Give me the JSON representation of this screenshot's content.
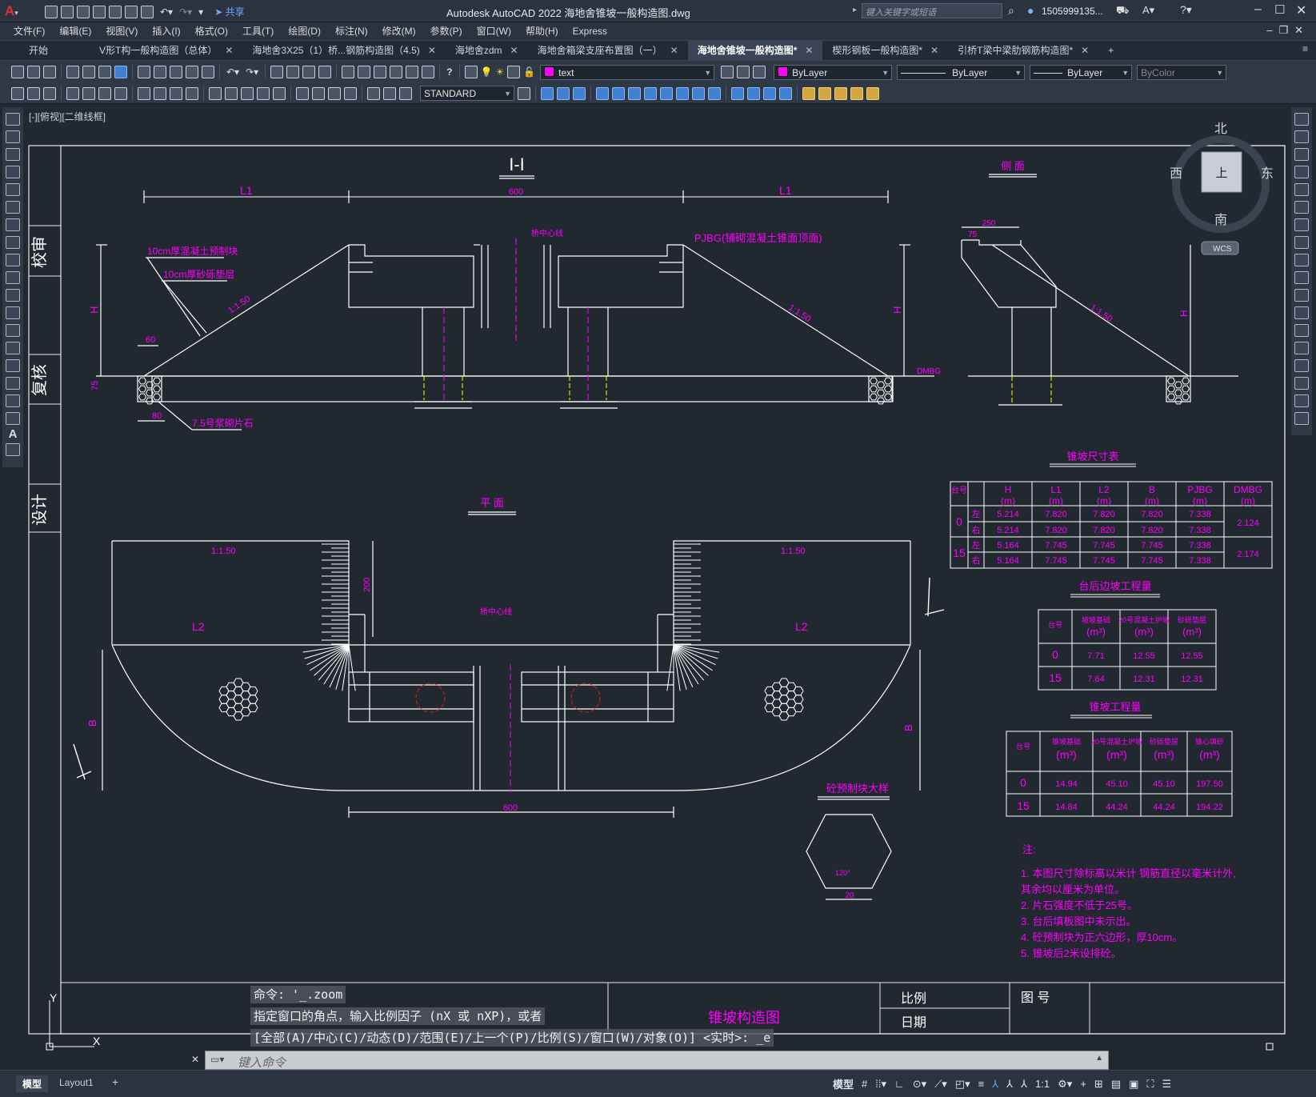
{
  "app": {
    "title": "Autodesk AutoCAD 2022    海地舍锥坡一般构造图.dwg",
    "search_placeholder": "键入关键字或短语",
    "user": "1505999135...",
    "share_label": "共享"
  },
  "menu": [
    "文件(F)",
    "编辑(E)",
    "视图(V)",
    "插入(I)",
    "格式(O)",
    "工具(T)",
    "绘图(D)",
    "标注(N)",
    "修改(M)",
    "参数(P)",
    "窗口(W)",
    "帮助(H)",
    "Express"
  ],
  "tabs": [
    {
      "label": "开始",
      "active": false
    },
    {
      "label": "V形T构一般构造图（总体）",
      "active": false
    },
    {
      "label": "海地舍3X25（1）桥...钢筋构造图（4.5)",
      "active": false
    },
    {
      "label": "海地舍zdm",
      "active": false
    },
    {
      "label": "海地舍箱梁支座布置图（一）",
      "active": false
    },
    {
      "label": "海地舍锥坡一般构造图*",
      "active": true
    },
    {
      "label": "楔形钢板一般构造图*",
      "active": false
    },
    {
      "label": "引桥T梁中梁肋钢筋构造图*",
      "active": false
    }
  ],
  "layer": {
    "name": "text",
    "color": "#ff00ff"
  },
  "properties": {
    "color": "ByLayer",
    "linetype": "ByLayer",
    "lineweight": "ByLayer",
    "plotstyle": "ByColor"
  },
  "textstyle": "STANDARD",
  "viewport_label": "[-][俯视][二维线框]",
  "viewcube": {
    "north": "北",
    "south": "南",
    "east": "东",
    "west": "西",
    "top": "上",
    "wcs": "WCS"
  },
  "drawing": {
    "border_labels": [
      "校审",
      "复核",
      "设计"
    ],
    "section_title": "I-I",
    "side_title": "侧 面",
    "plan_title": "平 面",
    "detail_title": "砼预制块大样",
    "slope_label": "1:1.50",
    "dims": {
      "l1": "L1",
      "l2": "L2",
      "span": "600",
      "h": "H",
      "b": "B",
      "d200": "200",
      "d60": "60",
      "d20": "20",
      "d75": "75",
      "d80": "80",
      "d250": "250",
      "d75b": "75",
      "d20b": "20",
      "angle": "120°"
    },
    "bridge_center": "桥中心线",
    "pjbg_note": "PJBG(铺砌混凝土锥面顶面)",
    "dmbg": "DMBG",
    "layer_note1": "10cm厚混凝土预制块",
    "layer_note2": "10cm厚砂砾垫层",
    "stone_note": "7.5号浆砌片石",
    "notes_header": "注:",
    "notes": [
      "1. 本图尺寸除标高以米计      钢筋直径以毫米计外,",
      "   其余均以厘米为单位。",
      "2. 片石强度不低于25号。",
      "3. 台后填板图中未示出。",
      "4. 砼预制块为正六边形，厚10cm。",
      "5. 锥坡后2米设排砼。"
    ],
    "footer": {
      "scale_label": "比例",
      "date_label": "日期",
      "drawing_no_label": "图 号",
      "title": "锥坡构造图"
    },
    "table1": {
      "title": "锥坡尺寸表",
      "headers": [
        "台号",
        "",
        "H (m)",
        "L1 (m)",
        "L2 (m)",
        "B (m)",
        "PJBG (m)",
        "DMBG (m)"
      ],
      "rows": [
        [
          "0",
          "左",
          "5.214",
          "7.820",
          "7.820",
          "7.820",
          "7.338",
          "2.124"
        ],
        [
          "",
          "右",
          "5.214",
          "7.820",
          "7.820",
          "7.820",
          "7.338",
          ""
        ],
        [
          "15",
          "左",
          "5.164",
          "7.745",
          "7.745",
          "7.745",
          "7.338",
          "2.174"
        ],
        [
          "",
          "右",
          "5.164",
          "7.745",
          "7.745",
          "7.745",
          "7.338",
          ""
        ]
      ]
    },
    "table2": {
      "title": "台后边坡工程量",
      "headers": [
        "台号",
        "坡坡基础 (m³)",
        "20号混凝土护坡 (m³)",
        "砂砾垫层 (m³)"
      ],
      "rows": [
        [
          "0",
          "7.71",
          "12.55",
          "12.55"
        ],
        [
          "15",
          "7.64",
          "12.31",
          "12.31"
        ]
      ]
    },
    "table3": {
      "title": "锥坡工程量",
      "headers": [
        "台号",
        "锥坡基础 (m³)",
        "20号混凝土护坡 (m³)",
        "砂砾垫层 (m³)",
        "锥心填砂 (m³)"
      ],
      "rows": [
        [
          "0",
          "14.94",
          "45.10",
          "45.10",
          "197.50"
        ],
        [
          "15",
          "14.84",
          "44.24",
          "44.24",
          "194.22"
        ]
      ]
    }
  },
  "command": {
    "history": [
      "命令: '_.zoom",
      "指定窗口的角点，输入比例因子 (nX 或 nXP)，或者",
      "[全部(A)/中心(C)/动态(D)/范围(E)/上一个(P)/比例(S)/窗口(W)/对象(O)] <实时>: _e"
    ],
    "placeholder": "键入命令"
  },
  "layout_tabs": [
    "模型",
    "Layout1"
  ],
  "status": {
    "model": "模型",
    "scale": "1:1"
  }
}
